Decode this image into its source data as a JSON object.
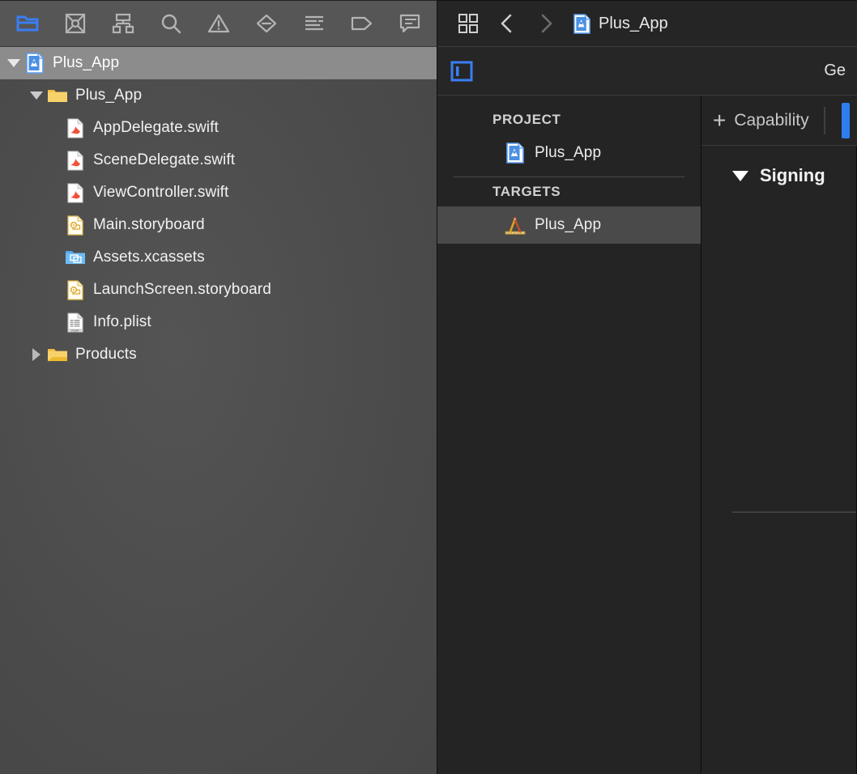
{
  "navigator": {
    "toolbar": [
      {
        "name": "project-navigator-icon",
        "icon": "folder",
        "active": true
      },
      {
        "name": "source-control-navigator-icon",
        "icon": "source-control",
        "active": false
      },
      {
        "name": "symbol-navigator-icon",
        "icon": "hierarchy",
        "active": false
      },
      {
        "name": "find-navigator-icon",
        "icon": "search",
        "active": false
      },
      {
        "name": "issue-navigator-icon",
        "icon": "warning-triangle",
        "active": false
      },
      {
        "name": "test-navigator-icon",
        "icon": "diamond-minus",
        "active": false
      },
      {
        "name": "debug-navigator-icon",
        "icon": "report-lines",
        "active": false
      },
      {
        "name": "breakpoint-navigator-icon",
        "icon": "tag",
        "active": false
      },
      {
        "name": "report-navigator-icon",
        "icon": "speech-bubble",
        "active": false
      }
    ],
    "tree": [
      {
        "label": "Plus_App",
        "icon": "xcode-project",
        "indent": 0,
        "twisty": "open",
        "selected": true
      },
      {
        "label": "Plus_App",
        "icon": "folder-yellow",
        "indent": 1,
        "twisty": "open",
        "selected": false
      },
      {
        "label": "AppDelegate.swift",
        "icon": "swift-file",
        "indent": 2,
        "twisty": "none",
        "selected": false
      },
      {
        "label": "SceneDelegate.swift",
        "icon": "swift-file",
        "indent": 2,
        "twisty": "none",
        "selected": false
      },
      {
        "label": "ViewController.swift",
        "icon": "swift-file",
        "indent": 2,
        "twisty": "none",
        "selected": false
      },
      {
        "label": "Main.storyboard",
        "icon": "storyboard-file",
        "indent": 2,
        "twisty": "none",
        "selected": false
      },
      {
        "label": "Assets.xcassets",
        "icon": "assets-catalog",
        "indent": 2,
        "twisty": "none",
        "selected": false
      },
      {
        "label": "LaunchScreen.storyboard",
        "icon": "storyboard-file",
        "indent": 2,
        "twisty": "none",
        "selected": false
      },
      {
        "label": "Info.plist",
        "icon": "plist-file",
        "indent": 2,
        "twisty": "none",
        "selected": false
      },
      {
        "label": "Products",
        "icon": "folder-yellow",
        "indent": 1,
        "twisty": "closed",
        "selected": false
      }
    ]
  },
  "editor": {
    "jumpbar": {
      "grid_icon": "related-items-icon",
      "back_label": "‹",
      "forward_label": "›",
      "document_icon": "xcode-project",
      "title": "Plus_App"
    },
    "tabbar": {
      "layout_toggle": "editor-layout-toggle-icon",
      "tabs": [
        {
          "label": "Ge",
          "name": "tab-general",
          "selected": true
        }
      ]
    },
    "project_list": {
      "project_header": "PROJECT",
      "projects": [
        {
          "label": "Plus_App",
          "icon": "xcode-project",
          "selected": false
        }
      ],
      "targets_header": "TARGETS",
      "targets": [
        {
          "label": "Plus_App",
          "icon": "target-app",
          "selected": true
        }
      ]
    },
    "detail": {
      "capability_plus": "+",
      "capability_label": "Capability",
      "sections": [
        {
          "label": "Signing",
          "expanded": true
        }
      ]
    }
  },
  "colors": {
    "accent_blue": "#2f7ef0",
    "navigator_bg": "#4d4d4d",
    "selection_gray": "#8c8c8c",
    "panel_dark": "#242424",
    "swift_orange": "#f05138",
    "folder_yellow": "#f2c14a"
  }
}
